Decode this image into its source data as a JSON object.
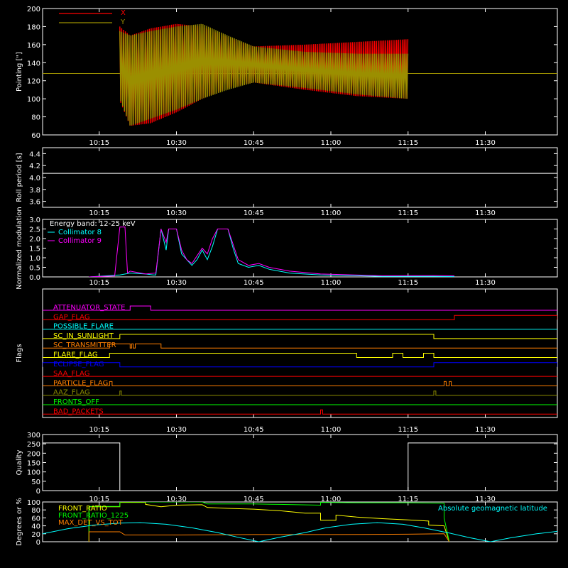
{
  "time_ticks": [
    "10:15",
    "10:30",
    "10:45",
    "11:00",
    "11:15",
    "11:30"
  ],
  "chart_data": [
    {
      "type": "line",
      "ylabel": "Pointing [\"]",
      "ylim": [
        60,
        200
      ],
      "yticks": [
        "60",
        "80",
        "100",
        "120",
        "140",
        "160",
        "180",
        "200"
      ],
      "legend": [
        {
          "name": "X",
          "color": "#ff0000"
        },
        {
          "name": "Y",
          "color": "#9b8f00"
        }
      ],
      "reference_line_value": 128,
      "x_range_start": "10:04",
      "x_range_end": "11:44",
      "data_start": "10:19",
      "data_end": "11:15",
      "series": [
        {
          "name": "X",
          "color": "#ff0000",
          "samples": [
            {
              "t": "10:19",
              "min": 98,
              "max": 180
            },
            {
              "t": "10:21",
              "min": 70,
              "max": 170
            },
            {
              "t": "10:25",
              "min": 73,
              "max": 178
            },
            {
              "t": "10:30",
              "min": 85,
              "max": 183
            },
            {
              "t": "10:35",
              "min": 100,
              "max": 180
            },
            {
              "t": "10:40",
              "min": 112,
              "max": 168
            },
            {
              "t": "10:45",
              "min": 118,
              "max": 158
            },
            {
              "t": "10:55",
              "min": 110,
              "max": 160
            },
            {
              "t": "11:05",
              "min": 103,
              "max": 163
            },
            {
              "t": "11:15",
              "min": 100,
              "max": 166
            }
          ]
        },
        {
          "name": "Y",
          "color": "#9b8f00",
          "samples": [
            {
              "t": "10:19",
              "min": 100,
              "max": 175
            },
            {
              "t": "10:21",
              "min": 70,
              "max": 170
            },
            {
              "t": "10:25",
              "min": 78,
              "max": 175
            },
            {
              "t": "10:30",
              "min": 88,
              "max": 180
            },
            {
              "t": "10:35",
              "min": 100,
              "max": 183
            },
            {
              "t": "10:40",
              "min": 110,
              "max": 170
            },
            {
              "t": "10:45",
              "min": 118,
              "max": 158
            },
            {
              "t": "10:55",
              "min": 112,
              "max": 152
            },
            {
              "t": "11:05",
              "min": 105,
              "max": 150
            },
            {
              "t": "11:15",
              "min": 100,
              "max": 150
            }
          ]
        }
      ]
    },
    {
      "type": "line",
      "ylabel": "Roll period [s]",
      "ylim": [
        3.5,
        4.5
      ],
      "yticks": [
        "3.6",
        "3.8",
        "4.0",
        "4.2",
        "4.4"
      ],
      "series": [
        {
          "name": "",
          "color": "#ffffff",
          "points": [
            [
              "10:04",
              4.07
            ],
            [
              "11:44",
              4.07
            ]
          ]
        }
      ]
    },
    {
      "type": "line",
      "ylabel": "Normalized modulation",
      "ylim": [
        0,
        3
      ],
      "yticks": [
        "0.0",
        "0.5",
        "1.0",
        "1.5",
        "2.0",
        "2.5",
        "3.0"
      ],
      "legend": [
        {
          "name": "Energy band: 12-25 keV",
          "color": "#ffffff"
        },
        {
          "name": "Collimator 8",
          "color": "#00ffff"
        },
        {
          "name": "Collimator 9",
          "color": "#ff00ff"
        }
      ],
      "series": [
        {
          "name": "Collimator 8",
          "color": "#00ffff",
          "points": [
            [
              "10:13",
              0
            ],
            [
              "10:19",
              0.1
            ],
            [
              "10:21",
              0.2
            ],
            [
              "10:24",
              0.15
            ],
            [
              "10:25.5",
              0.1
            ],
            [
              "10:26",
              0.1
            ],
            [
              "10:27",
              2.5
            ],
            [
              "10:28",
              1.4
            ],
            [
              "10:28.5",
              2.5
            ],
            [
              "10:30",
              2.5
            ],
            [
              "10:31",
              1.2
            ],
            [
              "10:32",
              0.9
            ],
            [
              "10:33",
              0.6
            ],
            [
              "10:34",
              0.9
            ],
            [
              "10:35",
              1.4
            ],
            [
              "10:36",
              0.9
            ],
            [
              "10:37",
              1.6
            ],
            [
              "10:38",
              2.5
            ],
            [
              "10:40",
              2.5
            ],
            [
              "10:41",
              1.5
            ],
            [
              "10:42",
              0.7
            ],
            [
              "10:44",
              0.5
            ],
            [
              "10:46",
              0.6
            ],
            [
              "10:48",
              0.4
            ],
            [
              "10:52",
              0.2
            ],
            [
              "10:58",
              0.1
            ],
            [
              "11:10",
              0.03
            ],
            [
              "11:20",
              0.03
            ],
            [
              "11:24",
              0.02
            ]
          ]
        },
        {
          "name": "Collimator 9",
          "color": "#ff00ff",
          "points": [
            [
              "10:13",
              0
            ],
            [
              "10:18",
              0.05
            ],
            [
              "10:19",
              2.6
            ],
            [
              "10:20",
              2.6
            ],
            [
              "10:20.5",
              0.2
            ],
            [
              "10:21",
              0.3
            ],
            [
              "10:24",
              0.15
            ],
            [
              "10:26",
              0.2
            ],
            [
              "10:27",
              2.5
            ],
            [
              "10:28",
              1.8
            ],
            [
              "10:28.5",
              2.5
            ],
            [
              "10:30",
              2.5
            ],
            [
              "10:31",
              1.4
            ],
            [
              "10:32",
              0.9
            ],
            [
              "10:33",
              0.7
            ],
            [
              "10:34",
              1.1
            ],
            [
              "10:35",
              1.5
            ],
            [
              "10:36",
              1.2
            ],
            [
              "10:37",
              2.0
            ],
            [
              "10:38",
              2.5
            ],
            [
              "10:40",
              2.5
            ],
            [
              "10:41",
              1.7
            ],
            [
              "10:42",
              0.9
            ],
            [
              "10:44",
              0.6
            ],
            [
              "10:46",
              0.7
            ],
            [
              "10:48",
              0.5
            ],
            [
              "10:52",
              0.3
            ],
            [
              "10:58",
              0.15
            ],
            [
              "11:10",
              0.06
            ],
            [
              "11:20",
              0.07
            ],
            [
              "11:24",
              0.05
            ]
          ]
        }
      ]
    },
    {
      "type": "line",
      "ylabel": "Flags",
      "flags": [
        {
          "name": "ATTENUATOR_STATE",
          "color": "#ff00ff",
          "high_intervals": [
            [
              "10:21",
              "10:25"
            ]
          ]
        },
        {
          "name": "GAP_FLAG",
          "color": "#ff0000",
          "high_intervals": [
            [
              "11:24",
              "11:44"
            ]
          ]
        },
        {
          "name": "POSSIBLE_FLARE",
          "color": "#00ffff",
          "high_intervals": []
        },
        {
          "name": "SC_IN_SUNLIGHT",
          "color": "#ffff00",
          "high_intervals": [
            [
              "10:19",
              "11:20"
            ]
          ]
        },
        {
          "name": "SC_TRANSMITTER",
          "color": "#ff7f00",
          "high_intervals": [
            [
              "10:17",
              "10:21"
            ],
            [
              "10:21.3",
              "10:21.6"
            ],
            [
              "10:22",
              "10:27"
            ]
          ]
        },
        {
          "name": "FLARE_FLAG",
          "color": "#ffff00",
          "high_intervals": [
            [
              "10:17",
              "11:05"
            ],
            [
              "11:12",
              "11:14"
            ],
            [
              "11:18",
              "11:20"
            ]
          ]
        },
        {
          "name": "ECLIPSE_FLAG",
          "color": "#0000ff",
          "high_intervals": [
            [
              "10:04",
              "10:19"
            ],
            [
              "11:20",
              "11:44"
            ]
          ]
        },
        {
          "name": "SAA_FLAG",
          "color": "#ff0000",
          "high_intervals": []
        },
        {
          "name": "PARTICLE_FLAG",
          "color": "#ff7f00",
          "high_intervals": [
            [
              "10:17",
              "10:17.5"
            ],
            [
              "11:22",
              "11:22.4"
            ],
            [
              "11:23",
              "11:23.4"
            ]
          ]
        },
        {
          "name": "AAZ_FLAG",
          "color": "#8c8c00",
          "high_intervals": [
            [
              "10:19",
              "10:19.3"
            ],
            [
              "11:20",
              "11:20.4"
            ]
          ]
        },
        {
          "name": "FRONTS_OFF",
          "color": "#00ff00",
          "high_intervals": []
        },
        {
          "name": "BAD_PACKETS",
          "color": "#ff0000",
          "high_intervals": [
            [
              "10:58",
              "10:58.4"
            ]
          ]
        }
      ]
    },
    {
      "type": "line",
      "ylabel": "Quality",
      "ylim": [
        0,
        300
      ],
      "yticks": [
        "0",
        "50",
        "100",
        "150",
        "200",
        "250",
        "300"
      ],
      "series": [
        {
          "name": "",
          "color": "#ffffff",
          "points": [
            [
              "10:04",
              255
            ],
            [
              "10:19",
              255
            ],
            [
              "10:19",
              0
            ],
            [
              "11:15",
              0
            ],
            [
              "11:15",
              255
            ],
            [
              "11:44",
              255
            ]
          ]
        }
      ]
    },
    {
      "type": "line",
      "ylabel": "Degrees or %",
      "ylim": [
        0,
        100
      ],
      "yticks": [
        "0",
        "20",
        "40",
        "60",
        "80",
        "100"
      ],
      "legend": [
        {
          "name": "FRONT_RATIO",
          "color": "#ffff00"
        },
        {
          "name": "FRONT_RATIO_1225",
          "color": "#00ff00"
        },
        {
          "name": "MAX_DET_VS_TOT",
          "color": "#ff7f00"
        },
        {
          "name": "Absolute geomagnetic latitude",
          "color": "#00ffff"
        }
      ],
      "series": [
        {
          "name": "FRONT_RATIO",
          "color": "#ffff00",
          "points": [
            [
              "10:13",
              0
            ],
            [
              "10:13",
              88
            ],
            [
              "10:19",
              88
            ],
            [
              "10:19",
              99
            ],
            [
              "10:24",
              99
            ],
            [
              "10:24",
              94
            ],
            [
              "10:27",
              88
            ],
            [
              "10:30",
              92
            ],
            [
              "10:35",
              93
            ],
            [
              "10:36",
              86
            ],
            [
              "10:40",
              84
            ],
            [
              "10:45",
              82
            ],
            [
              "10:50",
              78
            ],
            [
              "10:55",
              72
            ],
            [
              "10:58",
              72
            ],
            [
              "10:58",
              54
            ],
            [
              "11:01",
              54
            ],
            [
              "11:01",
              67
            ],
            [
              "11:05",
              62
            ],
            [
              "11:10",
              58
            ],
            [
              "11:15",
              55
            ],
            [
              "11:19",
              52
            ],
            [
              "11:19",
              42
            ],
            [
              "11:22",
              40
            ],
            [
              "11:23",
              0
            ]
          ]
        },
        {
          "name": "FRONT_RATIO_1225",
          "color": "#00ff00",
          "points": [
            [
              "10:13",
              0
            ],
            [
              "10:13",
              89
            ],
            [
              "10:19",
              89
            ],
            [
              "10:19",
              100
            ],
            [
              "10:35",
              100
            ],
            [
              "10:36",
              95
            ],
            [
              "10:45",
              95
            ],
            [
              "10:50",
              94
            ],
            [
              "10:58",
              92
            ],
            [
              "10:58",
              99
            ],
            [
              "11:05",
              98
            ],
            [
              "11:15",
              98
            ],
            [
              "11:22",
              97
            ],
            [
              "11:22",
              60
            ],
            [
              "11:23",
              0
            ]
          ]
        },
        {
          "name": "MAX_DET_VS_TOT",
          "color": "#ff7f00",
          "points": [
            [
              "10:13",
              0
            ],
            [
              "10:13",
              25
            ],
            [
              "10:19",
              25
            ],
            [
              "10:20",
              17
            ],
            [
              "10:30",
              17
            ],
            [
              "10:45",
              18
            ],
            [
              "11:00",
              18
            ],
            [
              "11:15",
              19
            ],
            [
              "11:22",
              20
            ],
            [
              "11:23",
              0
            ]
          ]
        },
        {
          "name": "Absolute geomagnetic latitude",
          "color": "#00ffff",
          "points": [
            [
              "10:04",
              20
            ],
            [
              "10:09",
              33
            ],
            [
              "10:14",
              42
            ],
            [
              "10:19",
              47
            ],
            [
              "10:23",
              48
            ],
            [
              "10:28",
              44
            ],
            [
              "10:33",
              35
            ],
            [
              "10:38",
              23
            ],
            [
              "10:42",
              11
            ],
            [
              "10:46",
              0
            ],
            [
              "10:50",
              11
            ],
            [
              "10:55",
              23
            ],
            [
              "10:59",
              35
            ],
            [
              "11:04",
              44
            ],
            [
              "11:09",
              48
            ],
            [
              "11:14",
              44
            ],
            [
              "11:18",
              35
            ],
            [
              "11:23",
              22
            ],
            [
              "11:27",
              10
            ],
            [
              "11:31",
              0
            ],
            [
              "11:35",
              10
            ],
            [
              "11:40",
              20
            ],
            [
              "11:44",
              26
            ]
          ]
        }
      ]
    }
  ]
}
